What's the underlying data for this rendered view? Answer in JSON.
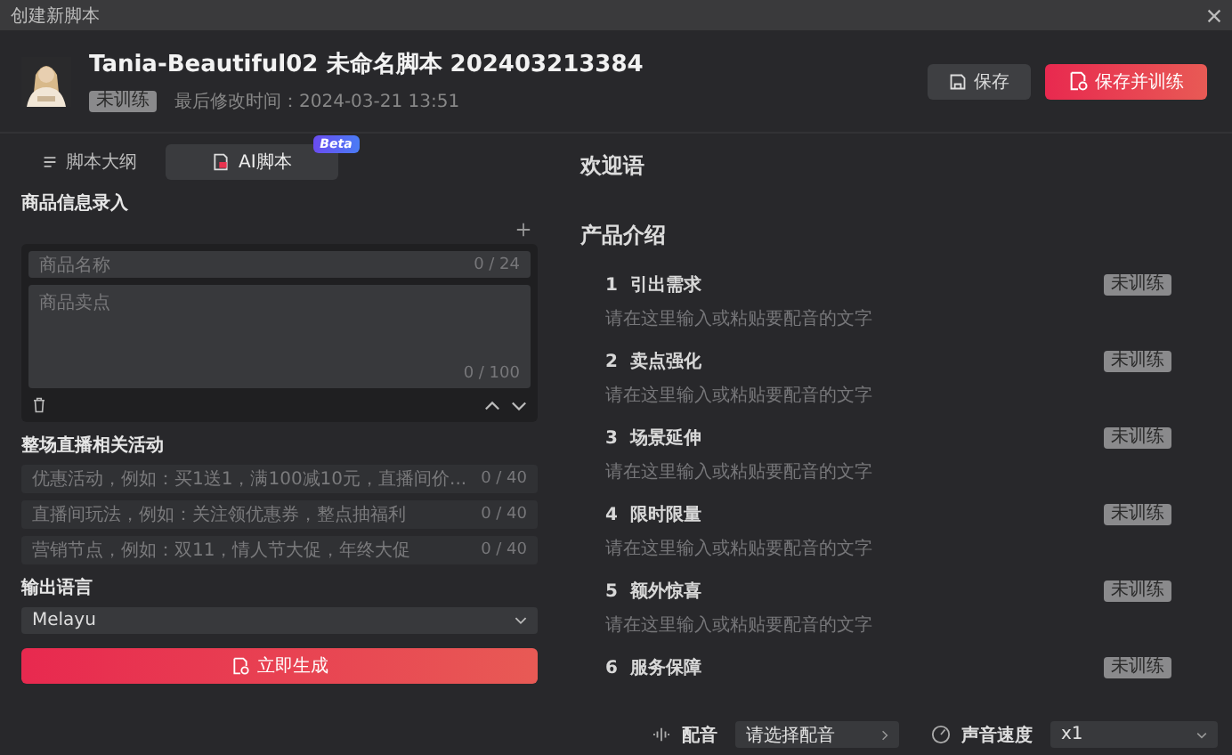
{
  "window": {
    "title": "创建新脚本"
  },
  "header": {
    "name": "Tania-Beautiful02 未命名脚本 202403213384",
    "status_tag": "未训练",
    "modified": "最后修改时间：2024-03-21 13:51",
    "buttons": [
      {
        "label": "保存",
        "kind": "secondary"
      },
      {
        "label": "保存并训练",
        "kind": "primary"
      }
    ]
  },
  "tabs": [
    {
      "label": "脚本大纲",
      "selected": false
    },
    {
      "label": "AI脚本",
      "selected": true,
      "badge": "Beta"
    }
  ],
  "product_section": {
    "title": "商品信息录入",
    "name_placeholder": "商品名称",
    "name_count": "0 / 24",
    "points_placeholder": "商品卖点",
    "points_count": "0 / 100"
  },
  "activities": {
    "title": "整场直播相关活动",
    "fields": [
      {
        "placeholder": "优惠活动，例如：买1送1，满100减10元，直播间价...",
        "count": "0 / 40"
      },
      {
        "placeholder": "直播间玩法，例如：关注领优惠券，整点抽福利",
        "count": "0 / 40"
      },
      {
        "placeholder": "营销节点，例如：双11，情人节大促，年终大促",
        "count": "0 / 40"
      }
    ]
  },
  "language": {
    "title": "输出语言",
    "value": "Melayu"
  },
  "generate_button": "立即生成",
  "script": {
    "welcome": "欢迎语",
    "intro_title": "产品介绍",
    "items": [
      {
        "number": "1",
        "title": "引出需求",
        "placeholder": "请在这里输入或粘贴要配音的文字",
        "tag": "未训练"
      },
      {
        "number": "2",
        "title": "卖点强化",
        "placeholder": "请在这里输入或粘贴要配音的文字",
        "tag": "未训练"
      },
      {
        "number": "3",
        "title": "场景延伸",
        "placeholder": "请在这里输入或粘贴要配音的文字",
        "tag": "未训练"
      },
      {
        "number": "4",
        "title": "限时限量",
        "placeholder": "请在这里输入或粘贴要配音的文字",
        "tag": "未训练"
      },
      {
        "number": "5",
        "title": "额外惊喜",
        "placeholder": "请在这里输入或粘贴要配音的文字",
        "tag": "未训练"
      },
      {
        "number": "6",
        "title": "服务保障",
        "tag": "未训练"
      }
    ]
  },
  "footer": {
    "voice_label": "配音",
    "voice_value": "请选择配音",
    "speed_label": "声音速度",
    "speed_value": "x1"
  }
}
